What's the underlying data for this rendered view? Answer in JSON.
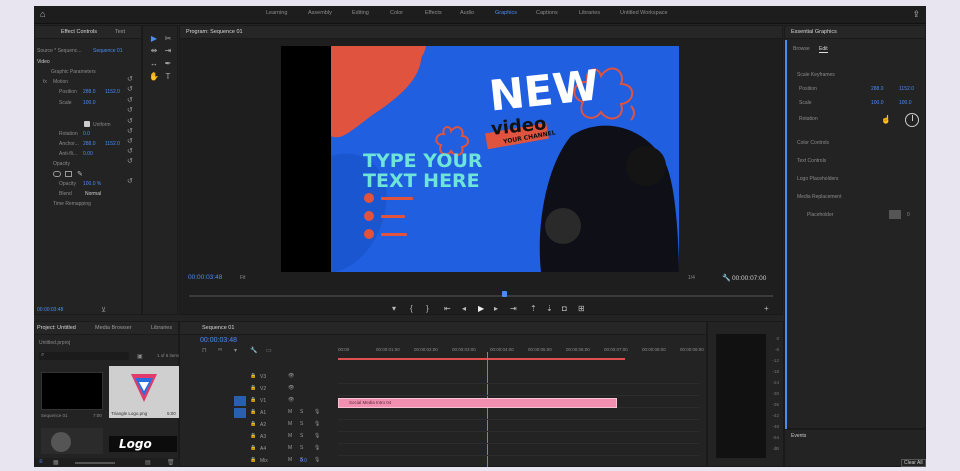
{
  "workspaces": [
    "Learning",
    "Assembly",
    "Editing",
    "Color",
    "Effects",
    "Audio",
    "Graphics",
    "Captions",
    "Libraries",
    "Untitled Workspace"
  ],
  "active_workspace": "Graphics",
  "effect_controls": {
    "tabs": [
      "Effect Controls",
      "Text"
    ],
    "source": "Source * Sequenc...",
    "sequence": "Sequence 01",
    "section": "Video",
    "graphic_params": "Graphic Parameters",
    "motion": "Motion",
    "position_label": "Position",
    "position_x": "288.0",
    "position_y": "1152.0",
    "scale_label": "Scale",
    "scale_value": "100.0",
    "uniform": "Uniform",
    "rotation_label": "Rotation",
    "rotation_value": "0.0",
    "anchor_label": "Anchor...",
    "anchor_x": "288.0",
    "anchor_y": "1152.0",
    "antiflicker_label": "Anti-fli...",
    "antiflicker_value": "0.00",
    "opacity_section": "Opacity",
    "opacity_label": "Opacity",
    "opacity_value": "100.0 %",
    "blend_label": "Blend",
    "blend_value": "Normal",
    "time_remap": "Time Remapping",
    "timecode": "00:00:03:48"
  },
  "program": {
    "title": "Program: Sequence 01",
    "timecode": "00:00:03:48",
    "fit": "Fit",
    "ratio": "1/4",
    "duration": "00:00:07:00",
    "artwork": {
      "new": "NEW",
      "video": "video",
      "your_channel": "YOUR CHANNEL",
      "type_line1": "TYPE YOUR",
      "type_line2": "TEXT HERE"
    }
  },
  "essential_graphics": {
    "title": "Essential Graphics",
    "tabs": [
      "Browse",
      "Edit"
    ],
    "scale_keyframes": "Scale Keyframes",
    "position_label": "Position",
    "position_x": "288.0",
    "position_y": "1152.0",
    "scale_label": "Scale",
    "scale_x": "100.0",
    "scale_y": "100.0",
    "rotation_label": "Rotation",
    "color_controls": "Color Controls",
    "text_controls": "Text Controls",
    "logo_placeholders": "Logo Placeholders",
    "media_replace": "Media Replacement",
    "placeholder": "Placeholder",
    "count": "0"
  },
  "project": {
    "tabs": [
      "Project: Untitled",
      "Media Browser",
      "Libraries"
    ],
    "filename": "Untitled.prproj",
    "items_count": "1 of 6 items",
    "items": [
      {
        "name": "Sequence 01",
        "dur": "7:00"
      },
      {
        "name": "Triangle Logo.png",
        "dur": "5:00"
      }
    ],
    "logo_text": "Logo"
  },
  "timeline": {
    "tab": "Sequence 01",
    "timecode": "00:00:03:48",
    "ruler": [
      "00:00",
      "00:00:01:00",
      "00:00:02:00",
      "00:00:03:00",
      "00:00:04:00",
      "00:00:05:00",
      "00:00:06:00",
      "00:00:07:00",
      "00:00:08:00",
      "00:00:09:00"
    ],
    "tracks": [
      "V3",
      "V2",
      "V1",
      "A1",
      "A2",
      "A3",
      "A4",
      "Mix"
    ],
    "mix_value": "0.0",
    "clip_name": "Social Media Intro 04"
  },
  "meters": [
    "0",
    "-6",
    "-12",
    "-18",
    "-24",
    "-30",
    "-36",
    "-42",
    "-48",
    "-54",
    "dB"
  ],
  "events": {
    "title": "Events",
    "clear": "Clear All"
  },
  "colors": {
    "accent": "#4a8cf0",
    "clip": "#f18fb0",
    "canvas": "#1f5fe0",
    "blob": "#e0533f",
    "teal": "#6fe4d8"
  }
}
